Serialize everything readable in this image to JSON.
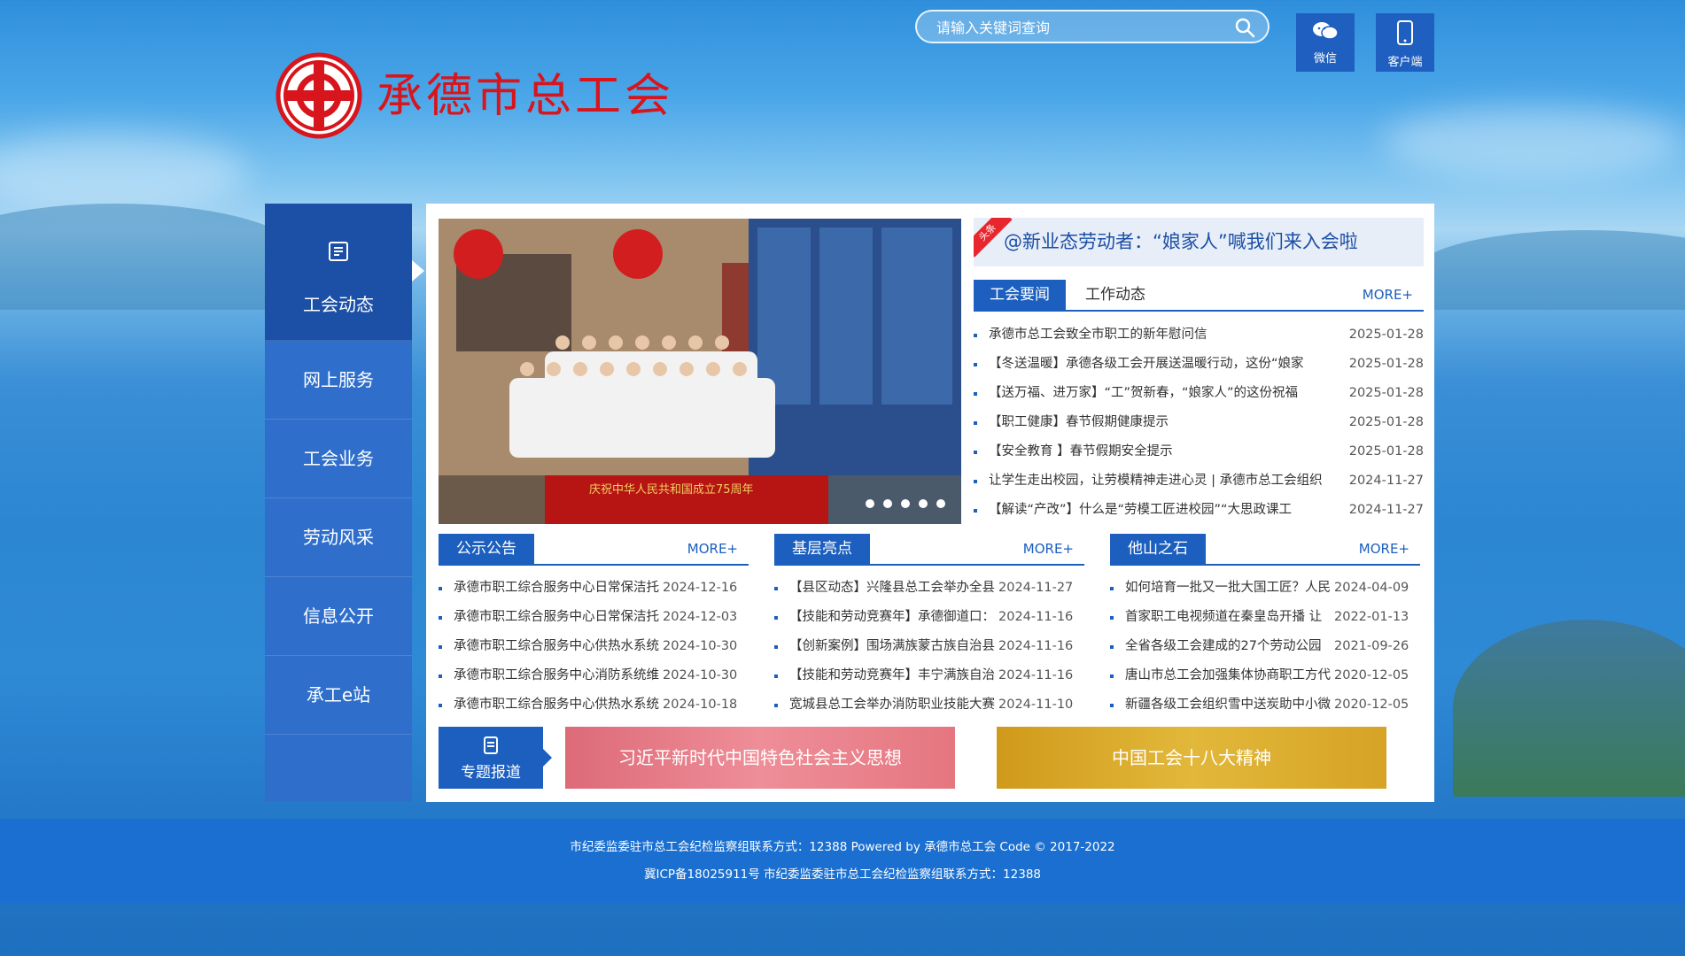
{
  "search": {
    "placeholder": "请输入关键词查询"
  },
  "tools": {
    "wechat": "微信",
    "client": "客户端"
  },
  "site": {
    "name": "承德市总工会"
  },
  "nav": {
    "items": [
      {
        "label": "工会动态"
      },
      {
        "label": "网上服务"
      },
      {
        "label": "工会业务"
      },
      {
        "label": "劳动风采"
      },
      {
        "label": "信息公开"
      },
      {
        "label": "承工e站"
      }
    ]
  },
  "banner": {
    "caption": "庆祝中华人民共和国成立75周年"
  },
  "headline": {
    "tag": "头条",
    "title": "@新业态劳动者：“娘家人”喊我们来入会啦"
  },
  "tabs": {
    "active": "工会要闻",
    "other": "工作动态",
    "more": "MORE+"
  },
  "news": [
    {
      "title": "承德市总工会致全市职工的新年慰问信",
      "date": "2025-01-28"
    },
    {
      "title": "【冬送温暖】承德各级工会开展送温暖行动，这份“娘家",
      "date": "2025-01-28"
    },
    {
      "title": "【送万福、进万家】“工”贺新春，“娘家人”的这份祝福",
      "date": "2025-01-28"
    },
    {
      "title": "【职工健康】春节假期健康提示",
      "date": "2025-01-28"
    },
    {
      "title": "【安全教育 】春节假期安全提示",
      "date": "2025-01-28"
    },
    {
      "title": "让学生走出校园，让劳模精神走进心灵 | 承德市总工会组织",
      "date": "2024-11-27"
    },
    {
      "title": "【解读“产改”】什么是“劳模工匠进校园”“大思政课工",
      "date": "2024-11-27"
    }
  ],
  "columns": [
    {
      "title": "公示公告",
      "more": "MORE+",
      "rows": [
        {
          "title": "承德市职工综合服务中心日常保洁托",
          "date": "2024-12-16"
        },
        {
          "title": "承德市职工综合服务中心日常保洁托",
          "date": "2024-12-03"
        },
        {
          "title": "承德市职工综合服务中心供热水系统",
          "date": "2024-10-30"
        },
        {
          "title": "承德市职工综合服务中心消防系统维",
          "date": "2024-10-30"
        },
        {
          "title": "承德市职工综合服务中心供热水系统",
          "date": "2024-10-18"
        }
      ]
    },
    {
      "title": "基层亮点",
      "more": "MORE+",
      "rows": [
        {
          "title": "【县区动态】兴隆县总工会举办全县",
          "date": "2024-11-27"
        },
        {
          "title": "【技能和劳动竞赛年】承德御道口：",
          "date": "2024-11-16"
        },
        {
          "title": "【创新案例】围场满族蒙古族自治县",
          "date": "2024-11-16"
        },
        {
          "title": "【技能和劳动竞赛年】丰宁满族自治",
          "date": "2024-11-16"
        },
        {
          "title": "宽城县总工会举办消防职业技能大赛",
          "date": "2024-11-10"
        }
      ]
    },
    {
      "title": "他山之石",
      "more": "MORE+",
      "rows": [
        {
          "title": "如何培育一批又一批大国工匠？人民",
          "date": "2024-04-09"
        },
        {
          "title": "首家职工电视频道在秦皇岛开播 让",
          "date": "2022-01-13"
        },
        {
          "title": "全省各级工会建成的27个劳动公园",
          "date": "2021-09-26"
        },
        {
          "title": "唐山市总工会加强集体协商职工方代",
          "date": "2020-12-05"
        },
        {
          "title": "新疆各级工会组织雪中送炭助中小微",
          "date": "2020-12-05"
        }
      ]
    }
  ],
  "special": {
    "label": "专题报道"
  },
  "promos": {
    "a": "习近平新时代中国特色社会主义思想",
    "b": "中国工会十八大精神"
  },
  "footer": {
    "line1": "市纪委监委驻市总工会纪检监察组联系方式：12388   Powered by 承德市总工会 Code © 2017-2022",
    "line2": "冀ICP备18025911号   市纪委监委驻市总工会纪检监察组联系方式：12388"
  },
  "colors": {
    "brand_red": "#d8141c",
    "brand_blue": "#1c5fbf",
    "nav_blue": "#2f6fcb"
  }
}
